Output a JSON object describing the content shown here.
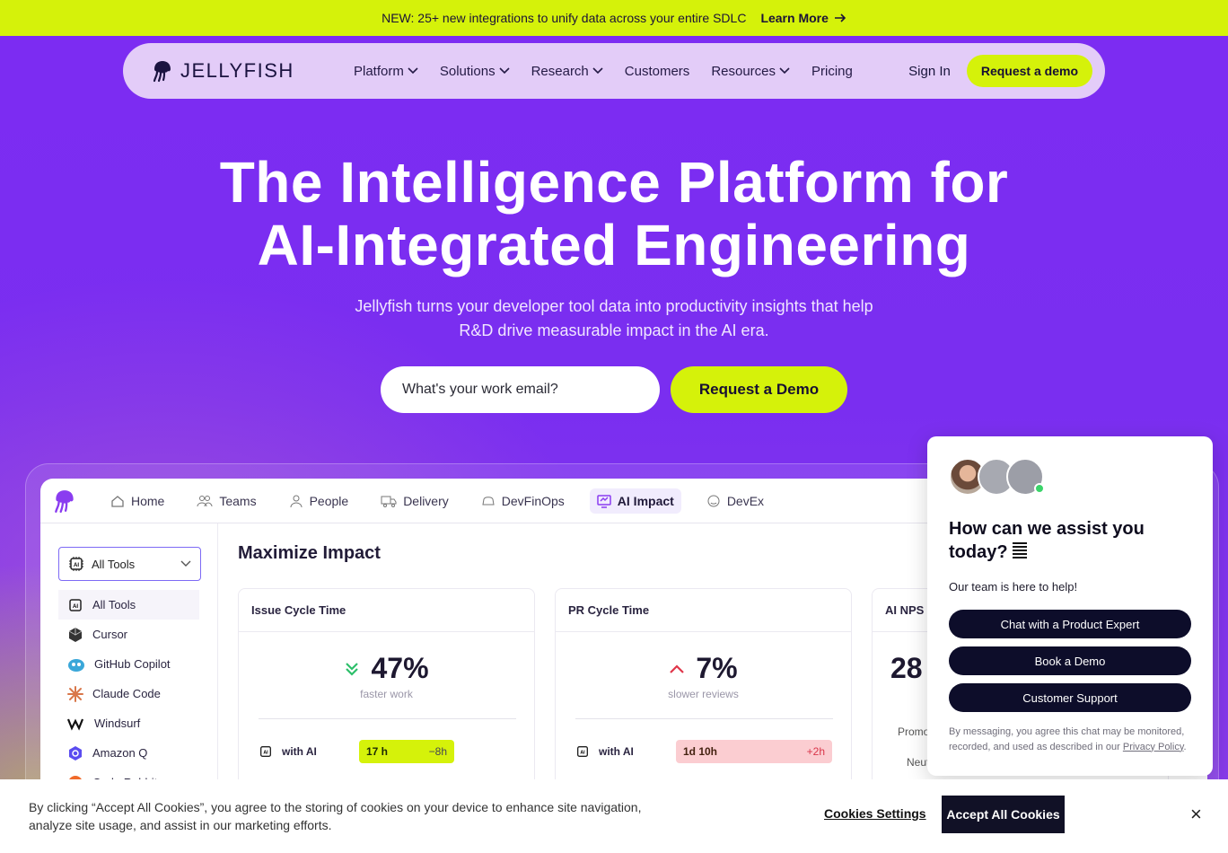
{
  "announcement": {
    "text": "NEW: 25+ new integrations to unify data across your entire SDLC",
    "link": "Learn More"
  },
  "nav": {
    "brand": "JELLYFISH",
    "items": [
      {
        "label": "Platform",
        "dropdown": true
      },
      {
        "label": "Solutions",
        "dropdown": true
      },
      {
        "label": "Research",
        "dropdown": true
      },
      {
        "label": "Customers",
        "dropdown": false
      },
      {
        "label": "Resources",
        "dropdown": true
      },
      {
        "label": "Pricing",
        "dropdown": false
      }
    ],
    "sign_in": "Sign In",
    "demo": "Request a demo"
  },
  "hero": {
    "title_line1": "The Intelligence Platform for",
    "title_line2": "AI-Integrated Engineering",
    "subtitle": "Jellyfish turns your developer tool data into productivity insights that help R&D drive measurable impact in the AI era.",
    "email_placeholder": "What's your work email?",
    "cta": "Request a Demo"
  },
  "app": {
    "tabs": [
      {
        "label": "Home",
        "icon": "home-icon"
      },
      {
        "label": "Teams",
        "icon": "teams-icon"
      },
      {
        "label": "People",
        "icon": "people-icon"
      },
      {
        "label": "Delivery",
        "icon": "delivery-icon"
      },
      {
        "label": "DevFinOps",
        "icon": "devfinops-icon"
      },
      {
        "label": "AI Impact",
        "icon": "ai-impact-icon",
        "active": true
      },
      {
        "label": "DevEx",
        "icon": "devex-icon"
      }
    ],
    "tool_select": "All Tools",
    "tools": [
      "All Tools",
      "Cursor",
      "GitHub Copilot",
      "Claude Code",
      "Windsurf",
      "Amazon Q",
      "Code Rabbit"
    ],
    "title": "Maximize Impact",
    "cards": [
      {
        "title": "Issue Cycle Time",
        "value": "47%",
        "sub": "faster work",
        "row_label": "with AI",
        "pill": "17 h",
        "delta": "−8h",
        "trend": "down",
        "color": "#2dbf6a"
      },
      {
        "title": "PR Cycle Time",
        "value": "7%",
        "sub": "slower reviews",
        "row_label": "with AI",
        "pill": "1d 10h",
        "delta": "+2h",
        "trend": "up",
        "color": "#e0364a"
      },
      {
        "title": "AI NPS",
        "value": "28",
        "extra1": "Promo",
        "extra2": "Neut"
      }
    ]
  },
  "chat": {
    "heading": "How can we assist you today?",
    "subtext": "Our team is here to help!",
    "buttons": [
      "Chat with a Product Expert",
      "Book a Demo",
      "Customer Support"
    ],
    "legal": "By messaging, you agree this chat may be monitored, recorded, and used as described in our",
    "legal_link": "Privacy Policy"
  },
  "cookie": {
    "text": "By clicking “Accept All Cookies”, you agree to the storing of cookies on your device to enhance site navigation, analyze site usage, and assist in our marketing efforts.",
    "settings": "Cookies Settings",
    "accept": "Accept All Cookies",
    "close": "×"
  },
  "colors": {
    "lime": "#d5f20a",
    "purple": "#7a2bf0",
    "navy": "#0d0d2a"
  }
}
